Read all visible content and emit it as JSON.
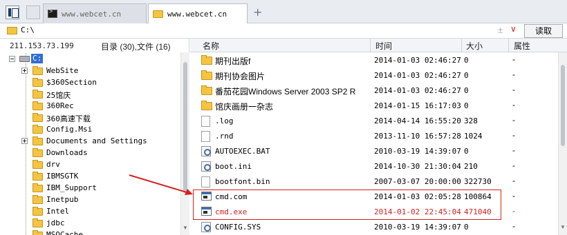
{
  "tabs": [
    {
      "label": "www.webcet.cn",
      "active": false
    },
    {
      "label": "www.webcet.cn",
      "active": true
    }
  ],
  "address": {
    "value": "C:\\",
    "read_label": "读取"
  },
  "left": {
    "ip": "211.153.73.199",
    "summary": "目录 (30),文件 (16)",
    "drive_label": "C:",
    "tree_items": [
      {
        "label": "WebSite",
        "expandable": true
      },
      {
        "label": "$360Section",
        "expandable": false
      },
      {
        "label": "25馆庆",
        "expandable": false
      },
      {
        "label": "360Rec",
        "expandable": false
      },
      {
        "label": "360高速下载",
        "expandable": false
      },
      {
        "label": "Config.Msi",
        "expandable": false
      },
      {
        "label": "Documents and Settings",
        "expandable": true
      },
      {
        "label": "Downloads",
        "expandable": false
      },
      {
        "label": "drv",
        "expandable": false
      },
      {
        "label": "IBMSGTK",
        "expandable": false
      },
      {
        "label": "IBM_Support",
        "expandable": false
      },
      {
        "label": "Inetpub",
        "expandable": false
      },
      {
        "label": "Intel",
        "expandable": false
      },
      {
        "label": "jdbc",
        "expandable": false
      },
      {
        "label": "MSOCache",
        "expandable": false
      }
    ]
  },
  "columns": {
    "name": "名称",
    "time": "时间",
    "size": "大小",
    "attr": "属性"
  },
  "files": [
    {
      "name": "期刊出版f",
      "time": "2014-01-03 02:46:27",
      "size": "0",
      "attr": "-",
      "icon": "folder-icon",
      "mono": false
    },
    {
      "name": "期刊协会图片",
      "time": "2014-01-03 02:46:27",
      "size": "0",
      "attr": "-",
      "icon": "folder-icon",
      "mono": false
    },
    {
      "name": "番茄花园Windows Server 2003 SP2 R",
      "time": "2014-01-03 02:46:27",
      "size": "0",
      "attr": "-",
      "icon": "folder-icon",
      "mono": false
    },
    {
      "name": "馆庆画册一杂志",
      "time": "2014-01-15 16:17:03",
      "size": "0",
      "attr": "-",
      "icon": "folder-icon",
      "mono": false
    },
    {
      "name": ".log",
      "time": "2014-04-14 16:55:20",
      "size": "328",
      "attr": "-",
      "icon": "document-icon",
      "mono": true
    },
    {
      "name": ".rnd",
      "time": "2013-11-10 16:57:28",
      "size": "1024",
      "attr": "-",
      "icon": "document-icon",
      "mono": true
    },
    {
      "name": "AUTOEXEC.BAT",
      "time": "2010-03-19 14:39:07",
      "size": "0",
      "attr": "-",
      "icon": "settings-file-icon",
      "mono": true
    },
    {
      "name": "boot.ini",
      "time": "2014-10-30 21:30:04",
      "size": "210",
      "attr": "-",
      "icon": "settings-file-icon",
      "mono": true
    },
    {
      "name": "bootfont.bin",
      "time": "2007-03-07 20:00:00",
      "size": "322730",
      "attr": "-",
      "icon": "document-icon",
      "mono": true
    },
    {
      "name": "cmd.com",
      "time": "2014-01-03 02:05:28",
      "size": "100864",
      "attr": "-",
      "icon": "executable-icon",
      "mono": true
    },
    {
      "name": "cmd.exe",
      "time": "2014-01-02 22:45:04",
      "size": "471040",
      "attr": "-",
      "icon": "executable-icon",
      "mono": true,
      "highlighted": true
    },
    {
      "name": "CONFIG.SYS",
      "time": "2010-03-19 14:39:07",
      "size": "0",
      "attr": "-",
      "icon": "settings-file-icon",
      "mono": true
    }
  ],
  "colors": {
    "highlight": "#d3201f",
    "selection": "#2f6fd6",
    "folder": "#f5c542"
  }
}
